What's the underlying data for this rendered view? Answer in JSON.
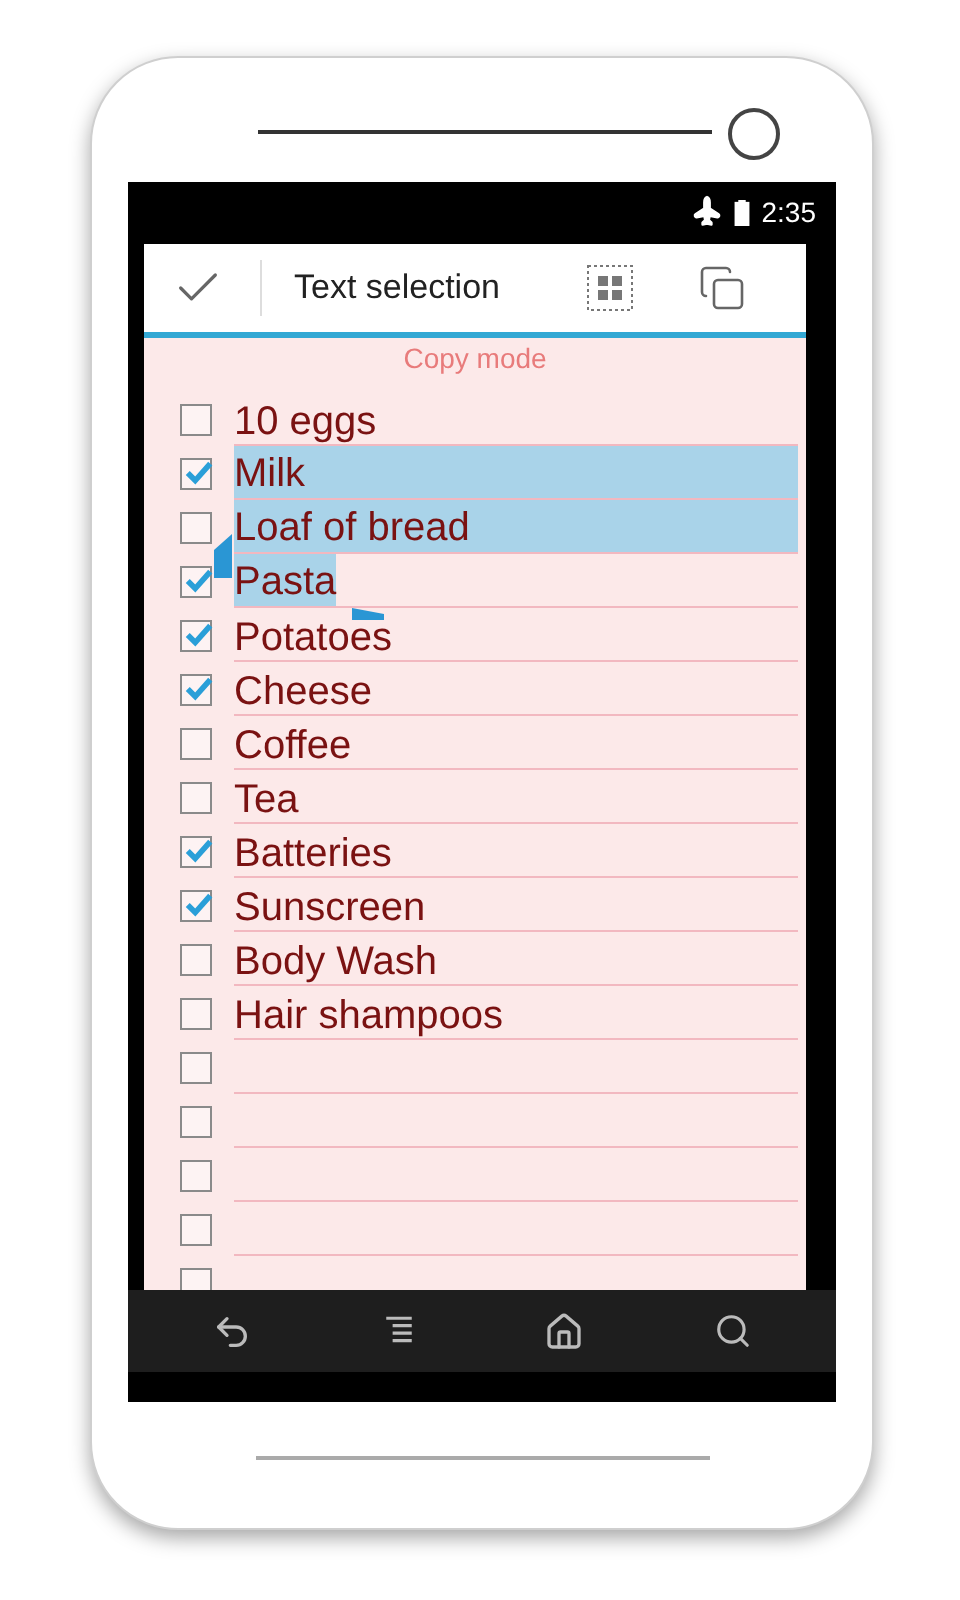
{
  "status_bar": {
    "time": "2:35"
  },
  "header": {
    "title": "Text selection"
  },
  "mode_label": "Copy mode",
  "items": [
    {
      "kind": "text",
      "text": "10 eggs",
      "checked": false,
      "selected": false
    },
    {
      "kind": "text",
      "text": "Milk",
      "checked": true,
      "selected": true
    },
    {
      "kind": "text",
      "text": "Loaf of bread",
      "checked": false,
      "selected": true
    },
    {
      "kind": "text",
      "text": "Pasta",
      "checked": true,
      "selected": true
    },
    {
      "kind": "text",
      "text": "Potatoes",
      "checked": true,
      "selected": false
    },
    {
      "kind": "text",
      "text": "Cheese",
      "checked": true,
      "selected": false
    },
    {
      "kind": "text",
      "text": "Coffee",
      "checked": false,
      "selected": false
    },
    {
      "kind": "text",
      "text": "Tea",
      "checked": false,
      "selected": false
    },
    {
      "kind": "text",
      "text": "Batteries",
      "checked": true,
      "selected": false
    },
    {
      "kind": "text",
      "text": "Sunscreen",
      "checked": true,
      "selected": false
    },
    {
      "kind": "text",
      "text": "Body Wash",
      "checked": false,
      "selected": false
    },
    {
      "kind": "text",
      "text": "Hair shampoos",
      "checked": false,
      "selected": false
    },
    {
      "kind": "blank",
      "checked": false
    },
    {
      "kind": "blank",
      "checked": false
    },
    {
      "kind": "blank",
      "checked": false
    },
    {
      "kind": "blank",
      "checked": false
    },
    {
      "kind": "blank",
      "checked": false
    }
  ]
}
